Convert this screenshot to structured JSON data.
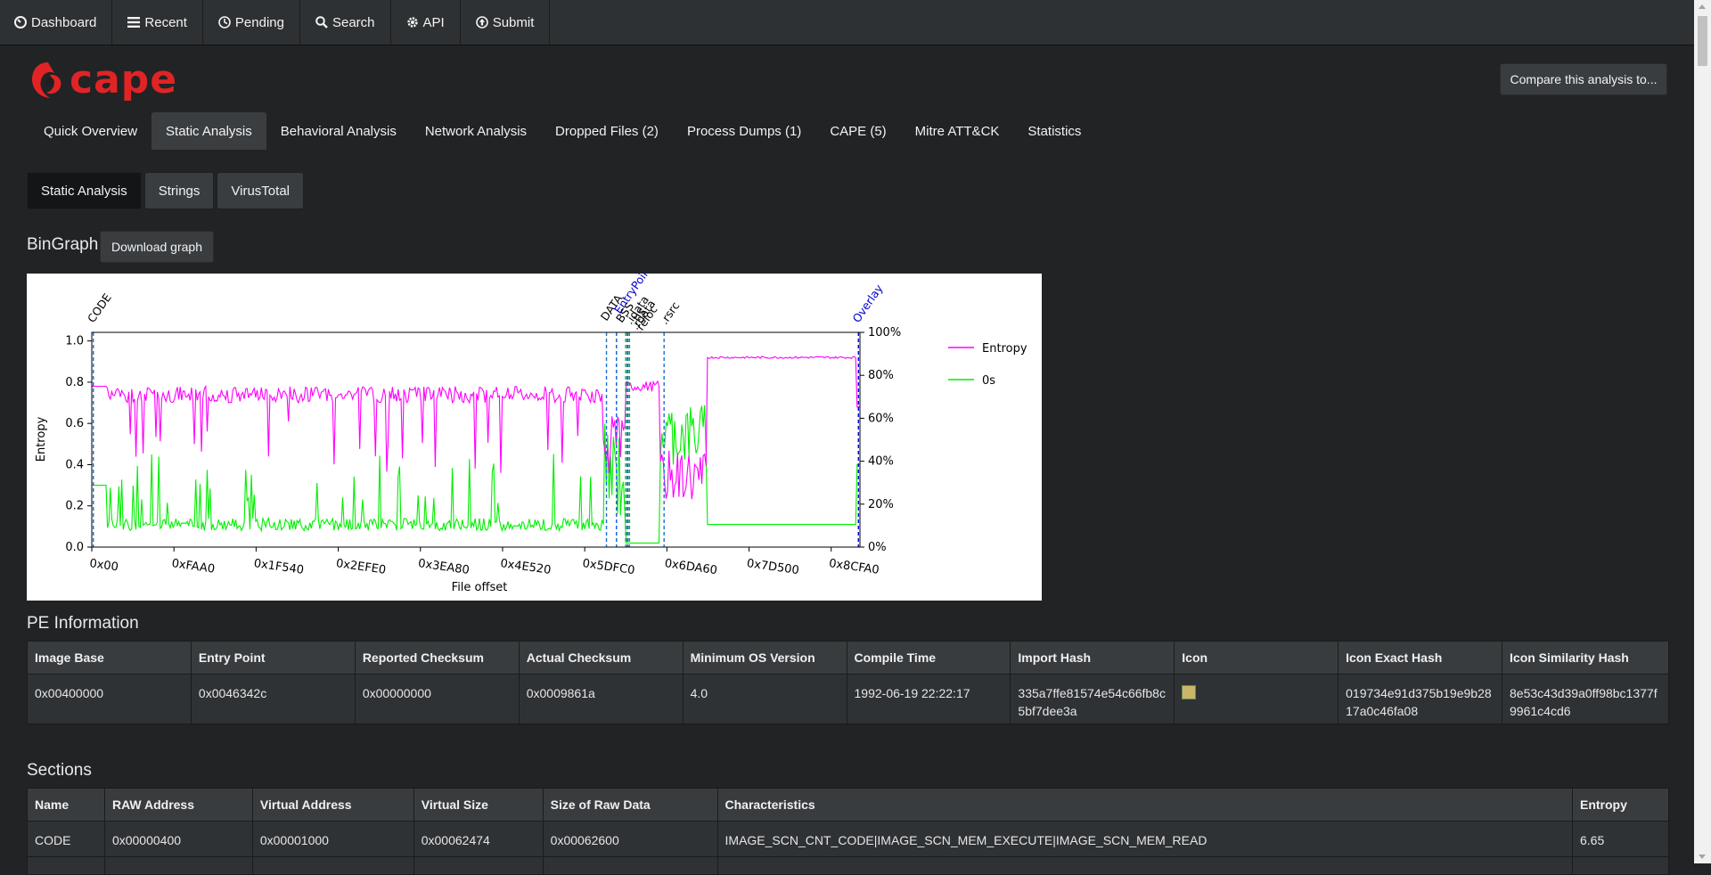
{
  "nav": [
    {
      "label": "Dashboard",
      "icon": "dashboard-icon"
    },
    {
      "label": "Recent",
      "icon": "list-icon"
    },
    {
      "label": "Pending",
      "icon": "clock-icon"
    },
    {
      "label": "Search",
      "icon": "search-icon"
    },
    {
      "label": "API",
      "icon": "gear-icon"
    },
    {
      "label": "Submit",
      "icon": "upload-circle-icon"
    }
  ],
  "brand": {
    "name": "cape",
    "color": "#e02426"
  },
  "compare_button": "Compare this analysis to...",
  "main_tabs": [
    {
      "label": "Quick Overview",
      "active": false
    },
    {
      "label": "Static Analysis",
      "active": true
    },
    {
      "label": "Behavioral Analysis",
      "active": false
    },
    {
      "label": "Network Analysis",
      "active": false
    },
    {
      "label": "Dropped Files (2)",
      "active": false
    },
    {
      "label": "Process Dumps (1)",
      "active": false
    },
    {
      "label": "CAPE (5)",
      "active": false
    },
    {
      "label": "Mitre ATT&CK",
      "active": false
    },
    {
      "label": "Statistics",
      "active": false
    }
  ],
  "sub_tabs": [
    {
      "label": "Static Analysis",
      "active": true
    },
    {
      "label": "Strings",
      "active": false
    },
    {
      "label": "VirusTotal",
      "active": false
    }
  ],
  "bingraph": {
    "title": "BinGraph",
    "download_label": "Download graph"
  },
  "chart_data": {
    "type": "line",
    "xlabel": "File offset",
    "ylabel": "Entropy",
    "x_ticks": [
      "0x00",
      "0xFAA0",
      "0x1F540",
      "0x2EFE0",
      "0x3EA80",
      "0x4E520",
      "0x5DFC0",
      "0x6DA60",
      "0x7D500",
      "0x8CFA0"
    ],
    "y_left_ticks": [
      "0.0",
      "0.2",
      "0.4",
      "0.6",
      "0.8",
      "1.0"
    ],
    "y_right_ticks": [
      "0%",
      "20%",
      "40%",
      "60%",
      "80%",
      "100%"
    ],
    "ylim": [
      0,
      1
    ],
    "legend": "right",
    "series": [
      {
        "name": "Entropy",
        "color": "#ff00ff"
      },
      {
        "name": "0s",
        "color": "#00ee00"
      }
    ],
    "section_markers": [
      {
        "label": "CODE",
        "color": "#000000"
      },
      {
        "label": "DATA",
        "color": "#000000"
      },
      {
        "label": "EntryPoint",
        "color": "#0000cc"
      },
      {
        "label": "BSS",
        "color": "#000000"
      },
      {
        "label": ".idata",
        "color": "#000000"
      },
      {
        "label": ".tls",
        "color": "#000000"
      },
      {
        "label": ".rdata",
        "color": "#000000"
      },
      {
        "label": ".reloc",
        "color": "#000000"
      },
      {
        "label": ".rsrc",
        "color": "#000000"
      },
      {
        "label": "Overlay",
        "color": "#0000cc"
      }
    ]
  },
  "pe_info": {
    "title": "PE Information",
    "headers": [
      "Image Base",
      "Entry Point",
      "Reported Checksum",
      "Actual Checksum",
      "Minimum OS Version",
      "Compile Time",
      "Import Hash",
      "Icon",
      "Icon Exact Hash",
      "Icon Similarity Hash"
    ],
    "row": [
      "0x00400000",
      "0x0046342c",
      "0x00000000",
      "0x0009861a",
      "4.0",
      "1992-06-19 22:22:17",
      "335a7ffe81574e54c66fb8c5bf7dee3a",
      "",
      "019734e91d375b19e9b2817a0c46fa08",
      "8e53c43d39a0ff98bc1377f9961c4cd6"
    ]
  },
  "sections": {
    "title": "Sections",
    "headers": [
      "Name",
      "RAW Address",
      "Virtual Address",
      "Virtual Size",
      "Size of Raw Data",
      "Characteristics",
      "Entropy"
    ],
    "rows": [
      [
        "CODE",
        "0x00000400",
        "0x00001000",
        "0x00062474",
        "0x00062600",
        "IMAGE_SCN_CNT_CODE|IMAGE_SCN_MEM_EXECUTE|IMAGE_SCN_MEM_READ",
        "6.65"
      ]
    ]
  }
}
